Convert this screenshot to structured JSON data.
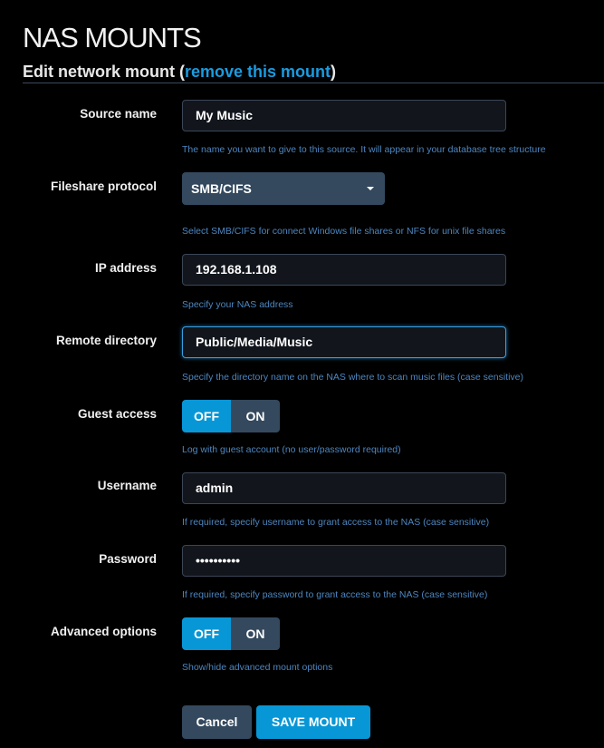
{
  "page": {
    "title": "NAS MOUNTS",
    "subtitle_prefix": "Edit network mount (",
    "remove_link": "remove this mount",
    "subtitle_suffix": ")"
  },
  "form": {
    "source_name": {
      "label": "Source name",
      "value": "My Music",
      "help": "The name you want to give to this source. It will appear in your database tree structure"
    },
    "protocol": {
      "label": "Fileshare protocol",
      "value": "SMB/CIFS",
      "help": "Select SMB/CIFS for connect Windows file shares or NFS for unix file shares"
    },
    "ip": {
      "label": "IP address",
      "value": "192.168.1.108",
      "help": "Specify your NAS address"
    },
    "remote_dir": {
      "label": "Remote directory",
      "value": "Public/Media/Music",
      "help": "Specify the directory name on the NAS where to scan music files (case sensitive)"
    },
    "guest": {
      "label": "Guest access",
      "off": "OFF",
      "on": "ON",
      "state": "OFF",
      "help": "Log with guest account (no user/password required)"
    },
    "username": {
      "label": "Username",
      "value": "admin",
      "help": "If required, specify username to grant access to the NAS (case sensitive)"
    },
    "password": {
      "label": "Password",
      "value": "••••••••••",
      "help": "If required, specify password to grant access to the NAS (case sensitive)"
    },
    "advanced": {
      "label": "Advanced options",
      "off": "OFF",
      "on": "ON",
      "state": "OFF",
      "help": "Show/hide advanced mount options"
    }
  },
  "buttons": {
    "cancel": "Cancel",
    "save": "SAVE MOUNT"
  },
  "colors": {
    "accent": "#0897d6",
    "secondary": "#34495e",
    "help_text": "#4d86c0",
    "background": "#000000"
  }
}
